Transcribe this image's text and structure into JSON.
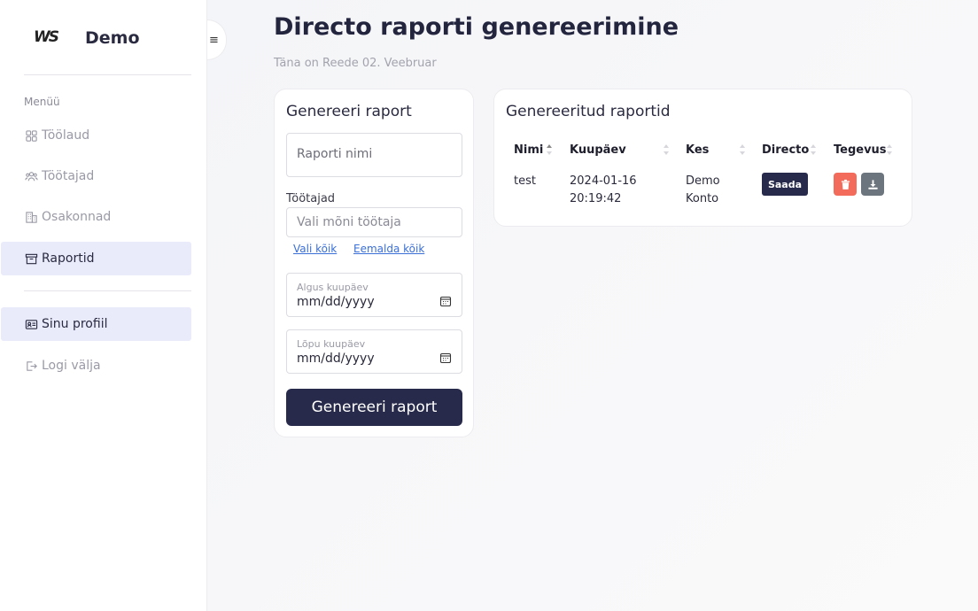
{
  "brand": {
    "logo": "WS",
    "name": "Demo"
  },
  "sidebar": {
    "menu_heading": "Menüü",
    "items": [
      {
        "label": "Töölaud",
        "icon": "dashboard-icon",
        "active": false
      },
      {
        "label": "Töötajad",
        "icon": "users-icon",
        "active": false
      },
      {
        "label": "Osakonnad",
        "icon": "building-icon",
        "active": false
      },
      {
        "label": "Raportid",
        "icon": "archive-icon",
        "active": true
      }
    ],
    "profile_items": [
      {
        "label": "Sinu profiil",
        "icon": "id-card-icon",
        "active": true
      },
      {
        "label": "Logi välja",
        "icon": "logout-icon",
        "active": false
      }
    ],
    "toggle_icon": "≡"
  },
  "page": {
    "title": "Directo raporti genereerimine",
    "subtitle": "Täna on Reede 02. Veebruar"
  },
  "generate_form": {
    "title": "Genereeri raport",
    "report_name_placeholder": "Raporti nimi",
    "employees_label": "Töötajad",
    "employees_placeholder": "Vali mõni töötaja",
    "select_all": "Vali kõik",
    "remove_all": "Eemalda kõik",
    "start_date_label": "Algus kuupäev",
    "start_date_value": "mm/dd/yyyy",
    "end_date_label": "Lõpu kuupäev",
    "end_date_value": "mm/dd/yyyy",
    "submit_label": "Genereeri raport"
  },
  "reports": {
    "title": "Genereeritud raportid",
    "columns": [
      "Nimi",
      "Kuupäev",
      "Kes",
      "Directo",
      "Tegevus"
    ],
    "rows": [
      {
        "name": "test",
        "date": "2024-01-16",
        "time": "20:19:42",
        "who_first": "Demo",
        "who_last": "Konto",
        "directo_label": "Saada",
        "actions": [
          "trash-icon",
          "download-icon"
        ]
      }
    ]
  },
  "colors": {
    "primary": "#272a4a",
    "danger": "#f26b5b",
    "secondary": "#6c757d",
    "active_nav": "#e9ebfb"
  }
}
